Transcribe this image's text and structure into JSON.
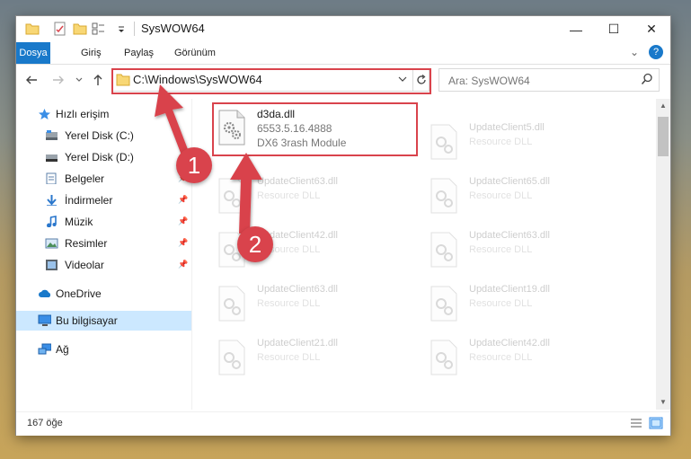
{
  "window": {
    "title": "SysWOW64",
    "controls": {
      "minimize": "—",
      "maximize": "☐",
      "close": "✕"
    }
  },
  "ribbon": {
    "tabs": [
      "Dosya",
      "Giriş",
      "Paylaş",
      "Görünüm"
    ],
    "help": "?",
    "collapse": "⌄"
  },
  "address_bar": {
    "path": "C:\\Windows\\SysWOW64"
  },
  "search": {
    "placeholder": "Ara: SysWOW64"
  },
  "nav_pane": {
    "items": [
      {
        "label": "Hızlı erişim",
        "icon": "star-icon"
      },
      {
        "label": "Yerel Disk (C:)",
        "icon": "drive-icon"
      },
      {
        "label": "Yerel Disk (D:)",
        "icon": "drive-icon"
      },
      {
        "label": "Belgeler",
        "icon": "documents-icon"
      },
      {
        "label": "İndirmeler",
        "icon": "download-icon"
      },
      {
        "label": "Müzik",
        "icon": "music-icon"
      },
      {
        "label": "Resimler",
        "icon": "pictures-icon"
      },
      {
        "label": "Videolar",
        "icon": "videos-icon"
      },
      {
        "label": "OneDrive",
        "icon": "cloud-icon"
      },
      {
        "label": "Bu bilgisayar",
        "icon": "computer-icon"
      },
      {
        "label": "Ağ",
        "icon": "network-icon"
      }
    ]
  },
  "files": [
    {
      "name": "d3da.dll",
      "version": "6553.5.16.4888",
      "description": "DX6 3rash Module"
    },
    {
      "name": "UpdateClient5.dll",
      "description": "Resource DLL"
    },
    {
      "name": "UpdateClient63.dll",
      "description": "Resource DLL"
    },
    {
      "name": "UpdateClient65.dll",
      "description": "Resource DLL"
    },
    {
      "name": "UpdateClient42.dll",
      "description": "Resource DLL"
    },
    {
      "name": "UpdateClient63.dll",
      "description": "Resource DLL"
    },
    {
      "name": "UpdateClient63.dll",
      "description": "Resource DLL"
    },
    {
      "name": "UpdateClient19.dll",
      "description": "Resource DLL"
    },
    {
      "name": "UpdateClient21.dll",
      "description": "Resource DLL"
    },
    {
      "name": "UpdateClient42.dll",
      "description": "Resource DLL"
    }
  ],
  "status": {
    "item_count": "167 öğe"
  },
  "annotations": {
    "step1": "1",
    "step2": "2",
    "color": "#d9434c"
  }
}
